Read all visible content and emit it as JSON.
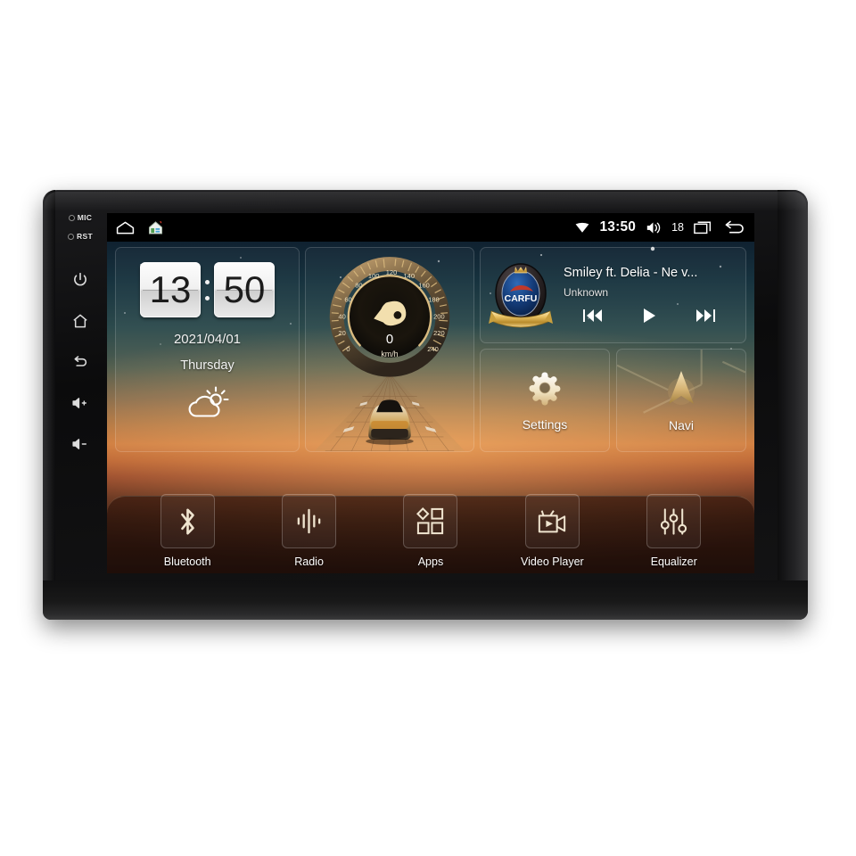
{
  "device": {
    "bezel_buttons": [
      {
        "name": "mic-indicator",
        "label": "MIC"
      },
      {
        "name": "reset-indicator",
        "label": "RST"
      },
      {
        "name": "power-button",
        "icon": "power-icon"
      },
      {
        "name": "home-button",
        "icon": "home-icon"
      },
      {
        "name": "back-button",
        "icon": "back-arrow-icon"
      },
      {
        "name": "volume-up-button",
        "icon": "volume-up-icon"
      },
      {
        "name": "volume-down-button",
        "icon": "volume-down-icon"
      }
    ]
  },
  "statusbar": {
    "left_icons": [
      {
        "name": "menu-icon",
        "label": "menu-icon"
      },
      {
        "name": "launcher-house-icon",
        "label": "house-app-icon"
      }
    ],
    "wifi_icon": "wifi-icon",
    "time": "13:50",
    "volume_icon": "volume-icon",
    "volume_level": "18",
    "recents_icon": "recent-apps-icon",
    "back_icon": "back-arrow-icon"
  },
  "clock_widget": {
    "hours": "13",
    "minutes": "50",
    "date": "2021/04/01",
    "weekday": "Thursday",
    "weather_icon": "partly-cloudy-icon"
  },
  "speed_widget": {
    "value": "0",
    "unit": "km/h",
    "ticks": [
      "0",
      "20",
      "40",
      "60",
      "80",
      "100",
      "120",
      "140",
      "160",
      "180",
      "200",
      "220",
      "240"
    ],
    "needle_icon": "speedometer-needle-icon",
    "car_icon": "car-rear-icon"
  },
  "media_widget": {
    "album_art": "carfu-badge-logo",
    "album_art_text": "CARFU",
    "title": "Smiley ft. Delia - Ne v...",
    "artist": "Unknown",
    "controls": [
      {
        "name": "previous-track-button",
        "icon": "skip-previous-icon"
      },
      {
        "name": "play-button",
        "icon": "play-icon"
      },
      {
        "name": "next-track-button",
        "icon": "skip-next-icon"
      }
    ]
  },
  "tiles": [
    {
      "name": "settings-tile",
      "label": "Settings",
      "icon": "gear-icon"
    },
    {
      "name": "navi-tile",
      "label": "Navi",
      "icon": "navigation-arrow-icon"
    }
  ],
  "dock": [
    {
      "name": "bluetooth",
      "label": "Bluetooth",
      "icon": "bluetooth-icon"
    },
    {
      "name": "radio",
      "label": "Radio",
      "icon": "radio-waves-icon"
    },
    {
      "name": "apps",
      "label": "Apps",
      "icon": "apps-grid-icon"
    },
    {
      "name": "video-player",
      "label": "Video Player",
      "icon": "camcorder-icon"
    },
    {
      "name": "equalizer",
      "label": "Equalizer",
      "icon": "equalizer-sliders-icon"
    }
  ],
  "colors": {
    "accent_gold": "#e8d3a0",
    "bezel": "#121213",
    "sky_top": "#0f2130",
    "sunset": "#c9743a",
    "ground": "#23120d"
  }
}
